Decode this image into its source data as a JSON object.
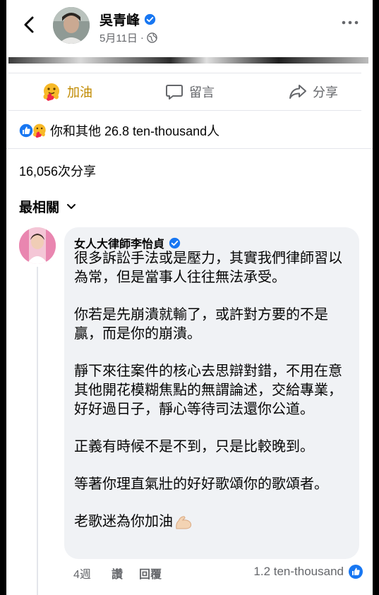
{
  "header": {
    "author_name": "吳青峰",
    "date": "5月11日",
    "separator": "·"
  },
  "actions": {
    "care_label": "加油",
    "comment_label": "留言",
    "share_label": "分享"
  },
  "reactions": {
    "summary": "你和其他 26.8 ten-thousand人"
  },
  "shares": {
    "text": "16,056次分享"
  },
  "sort": {
    "label": "最相關"
  },
  "comment": {
    "author": "女人大律師李怡貞",
    "paragraphs": [
      "很多訴訟手法或是壓力，其實我們律師習以為常，但是當事人往往無法承受。",
      "你若是先崩潰就輸了，或許對方要的不是贏，而是你的崩潰。",
      "靜下來往案件的核心去思辯對錯，不用在意其他開花模糊焦點的無謂論述，交給專業，好好過日子，靜心等待司法還你公道。",
      "正義有時候不是不到，只是比較晚到。",
      "等著你理直氣壯的好好歌頌你的歌頌者。",
      "老歌迷為你加油"
    ],
    "time": "4週",
    "like_action": "讚",
    "reply_action": "回覆",
    "like_count": "1.2 ten-thousand"
  },
  "colors": {
    "facebook_blue": "#1877f2",
    "care_gold": "#c08a00",
    "secondary_text": "#65676b",
    "bubble_bg": "#f0f2f5"
  },
  "icons": [
    "back-chevron-icon",
    "verified-badge-icon",
    "globe-icon",
    "more-icon",
    "care-reaction-icon",
    "comment-icon",
    "share-icon",
    "like-reaction-icon",
    "chevron-down-icon",
    "flexed-biceps-emoji"
  ]
}
